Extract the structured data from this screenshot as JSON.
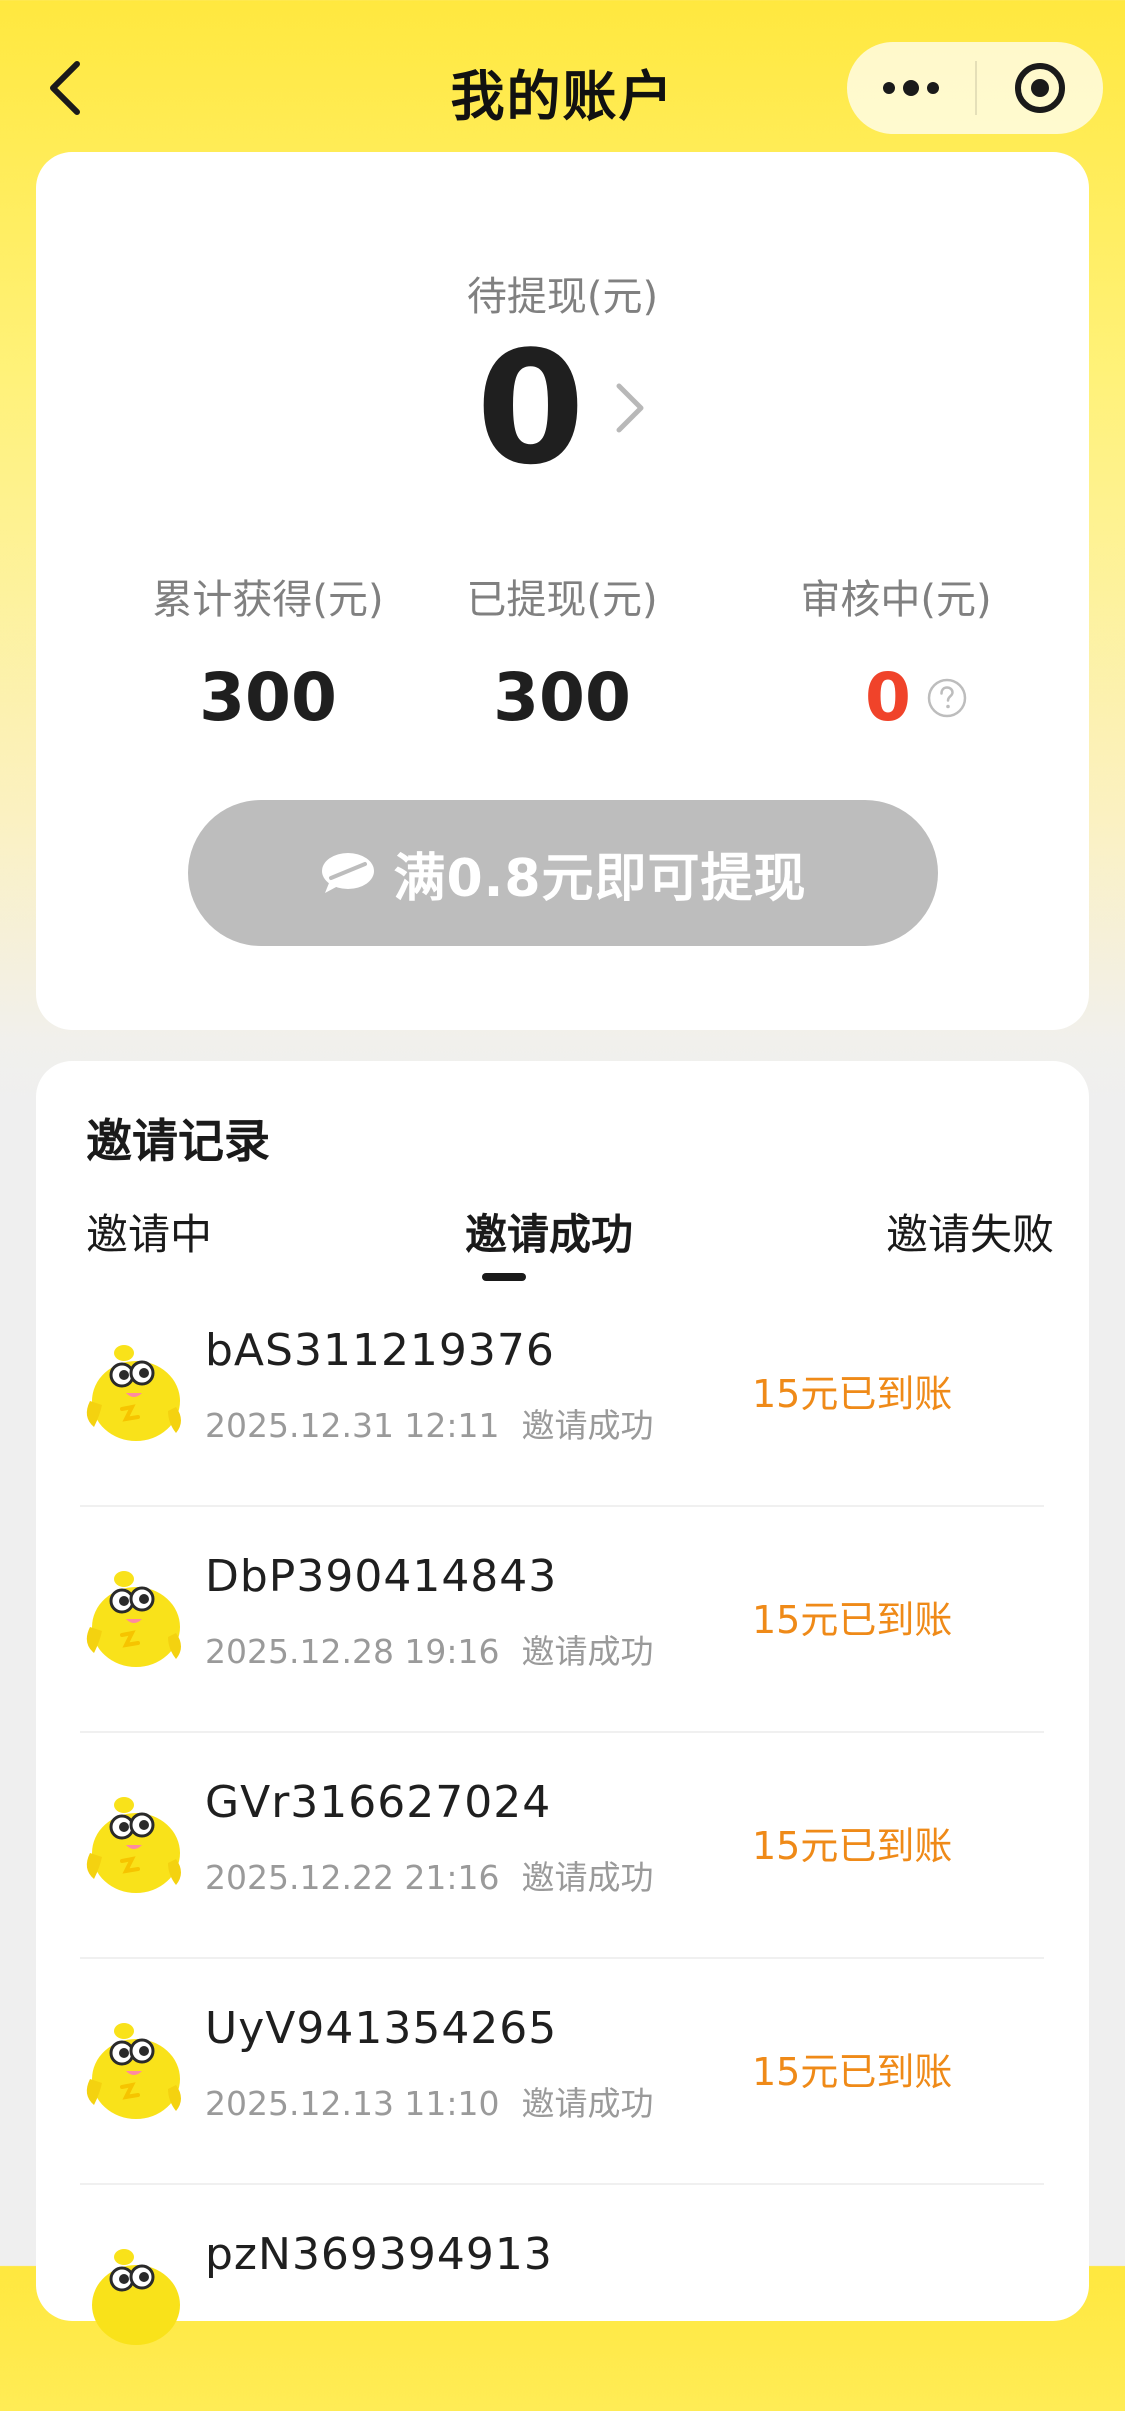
{
  "nav": {
    "title": "我的账户",
    "icons": {
      "back": "chevron-left-icon",
      "more": "more-dots-icon",
      "close": "record-target-icon"
    }
  },
  "balance": {
    "pending_label": "待提现(元)",
    "pending_amount": "0",
    "stats": [
      {
        "label": "累计获得(元)",
        "value": "300"
      },
      {
        "label": "已提现(元)",
        "value": "300"
      },
      {
        "label": "审核中(元)",
        "value": "0"
      }
    ],
    "withdraw_button": "满0.8元即可提现",
    "colors": {
      "button_bg": "#bdbdbd",
      "review_value": "#f0432a"
    }
  },
  "invites": {
    "title": "邀请记录",
    "tabs": [
      {
        "label": "邀请中",
        "active": false
      },
      {
        "label": "邀请成功",
        "active": true
      },
      {
        "label": "邀请失败",
        "active": false
      }
    ],
    "records": [
      {
        "name": "bAS311219376",
        "time": "2025.12.31 12:11",
        "status": "邀请成功",
        "reward": "15元已到账"
      },
      {
        "name": "DbP390414843",
        "time": "2025.12.28 19:16",
        "status": "邀请成功",
        "reward": "15元已到账"
      },
      {
        "name": "GVr316627024",
        "time": "2025.12.22 21:16",
        "status": "邀请成功",
        "reward": "15元已到账"
      },
      {
        "name": "UyV941354265",
        "time": "2025.12.13 11:10",
        "status": "邀请成功",
        "reward": "15元已到账"
      },
      {
        "name": "pzN369394913",
        "time": "",
        "status": "",
        "reward": ""
      }
    ],
    "colors": {
      "reward": "#ef8a18"
    }
  }
}
